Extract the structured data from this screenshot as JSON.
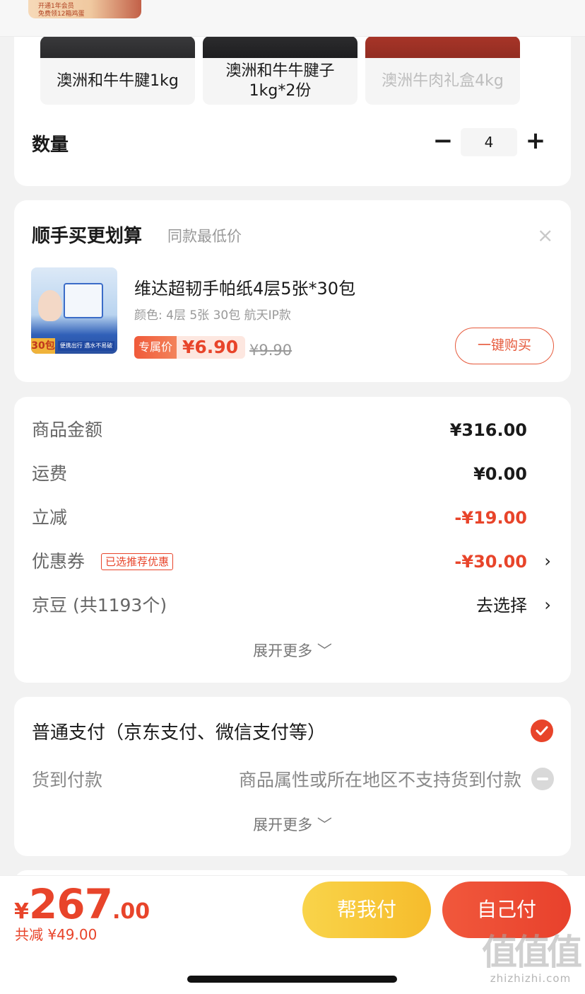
{
  "top_thumb_text": [
    "开通1年会员",
    "免费领12箱鸡蛋"
  ],
  "spec": {
    "options": [
      {
        "label": "澳洲和牛牛腱1kg",
        "disabled": false
      },
      {
        "label": "澳洲和牛牛腱子1kg*2份",
        "disabled": false
      },
      {
        "label": "澳洲牛肉礼盒4kg",
        "disabled": true
      }
    ],
    "quantity_label": "数量",
    "quantity_value": "4",
    "minus": "−",
    "plus": "+"
  },
  "upsell": {
    "title": "顺手买更划算",
    "subtitle": "同款最低价",
    "close": "×",
    "product_name": "维达超韧手帕纸4层5张*30包",
    "product_spec": "颜色: 4层 5张 30包 航天IP款",
    "exclusive_label": "专属价",
    "exclusive_price": "¥6.90",
    "original_price": "¥9.90",
    "buy_label": "一键购买",
    "image_badge": "30包",
    "image_stripe": "便携出行 遇水不易破"
  },
  "summary": {
    "rows": [
      {
        "label": "商品金额",
        "value": "¥316.00"
      },
      {
        "label": "运费",
        "value": "¥0.00"
      },
      {
        "label": "立减",
        "value": "-¥19.00"
      },
      {
        "label": "优惠券",
        "badge": "已选推荐优惠",
        "value": "-¥30.00"
      },
      {
        "label": "京豆 (共1193个)",
        "value": "去选择"
      }
    ],
    "chevron": "›",
    "expand_more": "展开更多 ﹀"
  },
  "payment": {
    "normal": "普通支付（京东支付、微信支付等）",
    "cod_label": "货到付款",
    "cod_note": "商品属性或所在地区不支持货到付款",
    "expand_more": "展开更多 ﹀"
  },
  "bottom_bar": {
    "currency": "¥",
    "total_int": "267",
    "total_dec": ".00",
    "saved": "共减 ¥49.00",
    "help_pay": "帮我付",
    "self_pay": "自己付"
  },
  "watermark": {
    "glyphs": "值值值",
    "url": "zhizhizhi.com"
  },
  "colors": {
    "accent_red": "#e8442a",
    "help_yellow": "#f6bc2c"
  }
}
